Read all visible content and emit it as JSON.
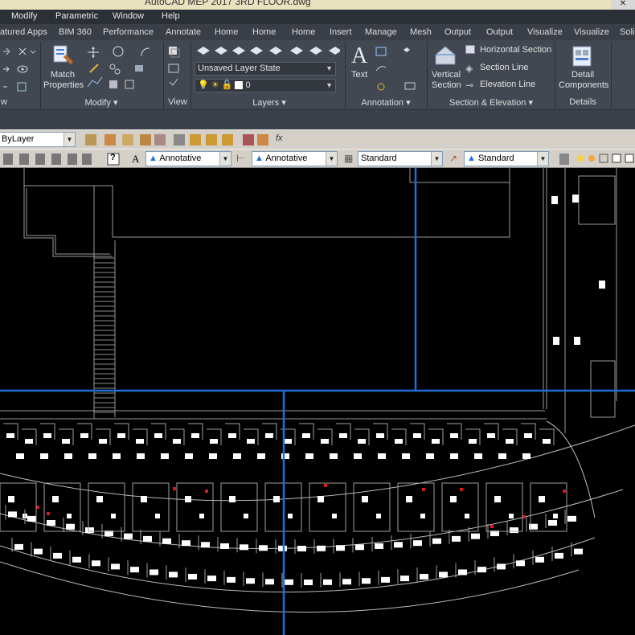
{
  "title_bar": {
    "title": "AutoCAD MEP 2017    3RD FLOOR.dwg"
  },
  "menu": [
    "Modify",
    "Parametric",
    "Window",
    "Help"
  ],
  "ribbon_tabs": [
    "atured Apps",
    "BIM 360",
    "Performance",
    "Annotate",
    "Home",
    "Home",
    "Home",
    "Insert",
    "Manage",
    "Mesh",
    "Output",
    "Output",
    "Visualize",
    "Visualize",
    "Soli"
  ],
  "ribbon": {
    "match_properties": {
      "line1": "Match",
      "line2": "Properties"
    },
    "layer_state": "Unsaved Layer State",
    "layer_current": "0",
    "text_label": "Text",
    "vertical_section": {
      "line1": "Vertical",
      "line2": "Section"
    },
    "horizontal_section": "Horizontal Section",
    "section_line": "Section Line",
    "elevation_line": "Elevation Line",
    "detail_components": {
      "line1": "Detail",
      "line2": "Components"
    },
    "panels": {
      "left_stub": "w",
      "modify": "Modify",
      "view": "View",
      "layers": "Layers",
      "annotation": "Annotation",
      "section_elevation": "Section & Elevation",
      "details": "Details"
    }
  },
  "toolbar": {
    "bylayer": "ByLayer",
    "fx": "fx",
    "text_style": "Annotative",
    "dim_style": "Annotative",
    "table_style": "Standard",
    "mleader_style": "Standard"
  },
  "colors": {
    "ribbon_bg": "#424852",
    "menubar_bg": "#2b2f36",
    "canvas_bg": "#000000",
    "crosshair": "#1e6fd9",
    "drawing_lines": "#bdbdbd",
    "marker_red": "#e01818"
  }
}
